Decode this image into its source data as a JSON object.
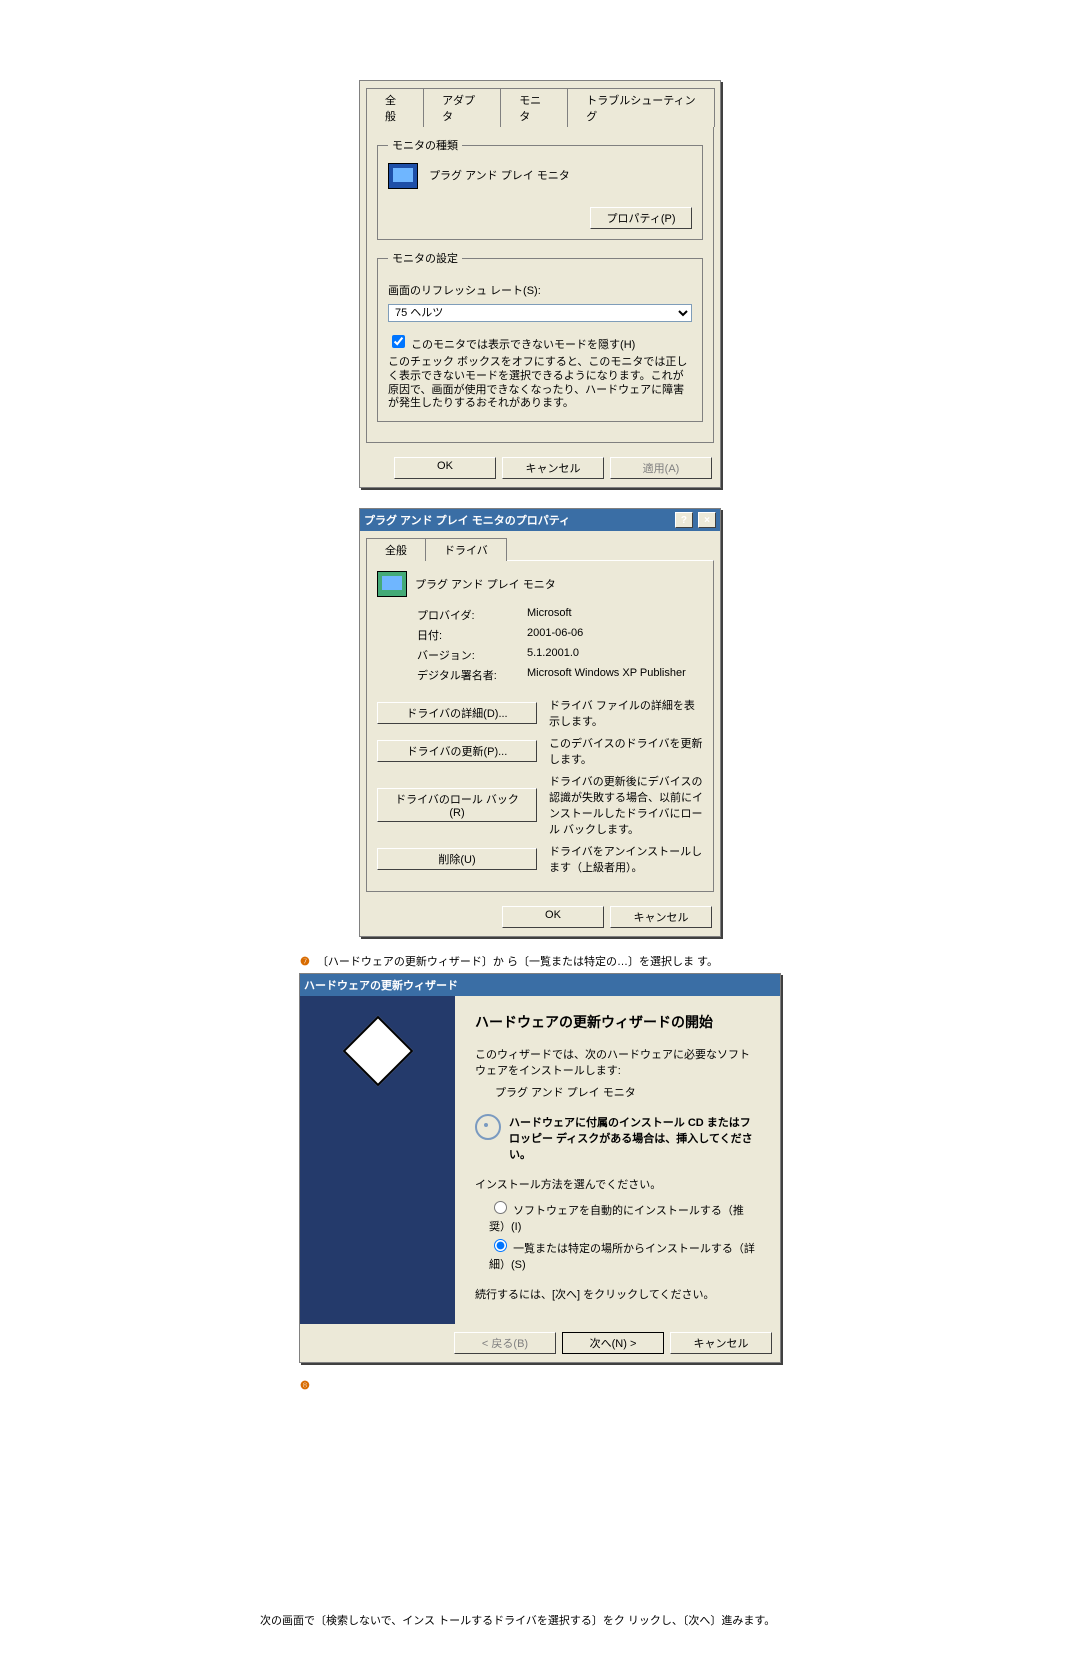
{
  "dlg1": {
    "tabs": [
      "全般",
      "アダプタ",
      "モニタ",
      "トラブルシューティング"
    ],
    "monitor_type_legend": "モニタの種類",
    "monitor_name": "プラグ アンド プレイ モニタ",
    "properties_btn": "プロパティ(P)",
    "monitor_settings_legend": "モニタの設定",
    "refresh_label": "画面のリフレッシュ レート(S):",
    "refresh_value": "75 ヘルツ",
    "hide_modes_checkbox": "このモニタでは表示できないモードを隠す(H)",
    "hide_modes_hint": "このチェック ボックスをオフにすると、このモニタでは正しく表示できないモードを選択できるようになります。これが原因で、画面が使用できなくなったり、ハードウェアに障害が発生したりするおそれがあります。",
    "ok": "OK",
    "cancel": "キャンセル",
    "apply": "適用(A)"
  },
  "dlg2": {
    "title": "プラグ アンド プレイ モニタのプロパティ",
    "tabs": [
      "全般",
      "ドライバ"
    ],
    "device_name": "プラグ アンド プレイ モニタ",
    "kv": {
      "provider_k": "プロバイダ:",
      "provider_v": "Microsoft",
      "date_k": "日付:",
      "date_v": "2001-06-06",
      "version_k": "バージョン:",
      "version_v": "5.1.2001.0",
      "signer_k": "デジタル署名者:",
      "signer_v": "Microsoft Windows XP Publisher"
    },
    "btns": {
      "details": "ドライバの詳細(D)...",
      "details_d": "ドライバ ファイルの詳細を表示します。",
      "update": "ドライバの更新(P)...",
      "update_d": "このデバイスのドライバを更新します。",
      "rollback": "ドライバのロール バック(R)",
      "rollback_d": "ドライバの更新後にデバイスの認識が失敗する場合、以前にインストールしたドライバにロール バックします。",
      "uninstall": "削除(U)",
      "uninstall_d": "ドライバをアンインストールします（上級者用）。"
    },
    "ok": "OK",
    "cancel": "キャンセル"
  },
  "step7": {
    "num": "❼",
    "text": "〔ハードウェアの更新ウィザード〕か ら〔一覧または特定の…〕を選択しま す。"
  },
  "wizard": {
    "title": "ハードウェアの更新ウィザード",
    "heading": "ハードウェアの更新ウィザードの開始",
    "intro": "このウィザードでは、次のハードウェアに必要なソフトウェアをインストールします:",
    "device": "プラグ アンド プレイ モニタ",
    "cd_hint": "ハードウェアに付属のインストール CD またはフロッピー ディスクがある場合は、挿入してください。",
    "choose": "インストール方法を選んでください。",
    "opt_auto": "ソフトウェアを自動的にインストールする（推奨）(I)",
    "opt_list": "一覧または特定の場所からインストールする（詳細）(S)",
    "cont": "続行するには、[次へ] をクリックしてください。",
    "back": "< 戻る(B)",
    "next": "次へ(N) >",
    "cancel": "キャンセル"
  },
  "step8": {
    "num": "❽"
  },
  "footer": "次の画面で〔検索しないで、インス トールするドライバを選択する〕をク リックし、〔次へ〕進みます。"
}
